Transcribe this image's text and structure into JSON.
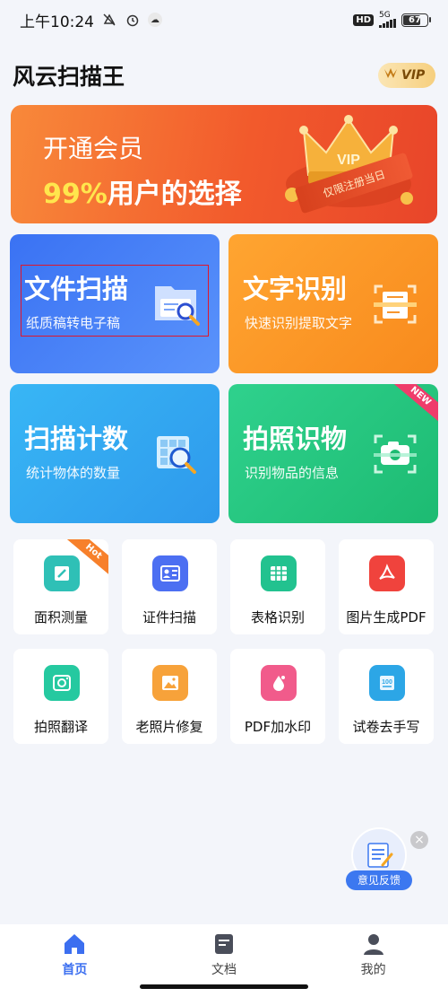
{
  "status_bar": {
    "time": "上午10:24",
    "network": "5G",
    "hd": "HD",
    "battery": "67",
    "battery_level": 0.67
  },
  "header": {
    "title": "风云扫描王",
    "vip_label": "VIP"
  },
  "banner": {
    "line1": "开通会员",
    "percent": "99%",
    "line2": "用户的选择",
    "badge_text": "VIP",
    "ribbon_text": "仅限注册当日"
  },
  "features": [
    {
      "title": "文件扫描",
      "subtitle": "纸质稿转电子稿"
    },
    {
      "title": "文字识别",
      "subtitle": "快速识别提取文字"
    },
    {
      "title": "扫描计数",
      "subtitle": "统计物体的数量"
    },
    {
      "title": "拍照识物",
      "subtitle": "识别物品的信息",
      "tag": "NEW"
    }
  ],
  "tools": [
    {
      "label": "面积测量",
      "icon": "ruler-icon",
      "color": "#2fc0b6",
      "tag": "Hot"
    },
    {
      "label": "证件扫描",
      "icon": "id-card-icon",
      "color": "#4c6ff2"
    },
    {
      "label": "表格识别",
      "icon": "table-icon",
      "color": "#22c28f"
    },
    {
      "label": "图片生成PDF",
      "icon": "pdf-icon",
      "color": "#f0433d"
    },
    {
      "label": "拍照翻译",
      "icon": "camera-icon",
      "color": "#25c9a0"
    },
    {
      "label": "老照片修复",
      "icon": "photo-icon",
      "color": "#f7a23a"
    },
    {
      "label": "PDF加水印",
      "icon": "watermark-icon",
      "color": "#f15b8b"
    },
    {
      "label": "试卷去手写",
      "icon": "exam-icon",
      "color": "#2ca6e6"
    }
  ],
  "feedback": {
    "label": "意见反馈",
    "close": "×"
  },
  "nav": [
    {
      "label": "首页",
      "icon": "home-icon",
      "active": true
    },
    {
      "label": "文档",
      "icon": "document-icon",
      "active": false
    },
    {
      "label": "我的",
      "icon": "profile-icon",
      "active": false
    }
  ]
}
